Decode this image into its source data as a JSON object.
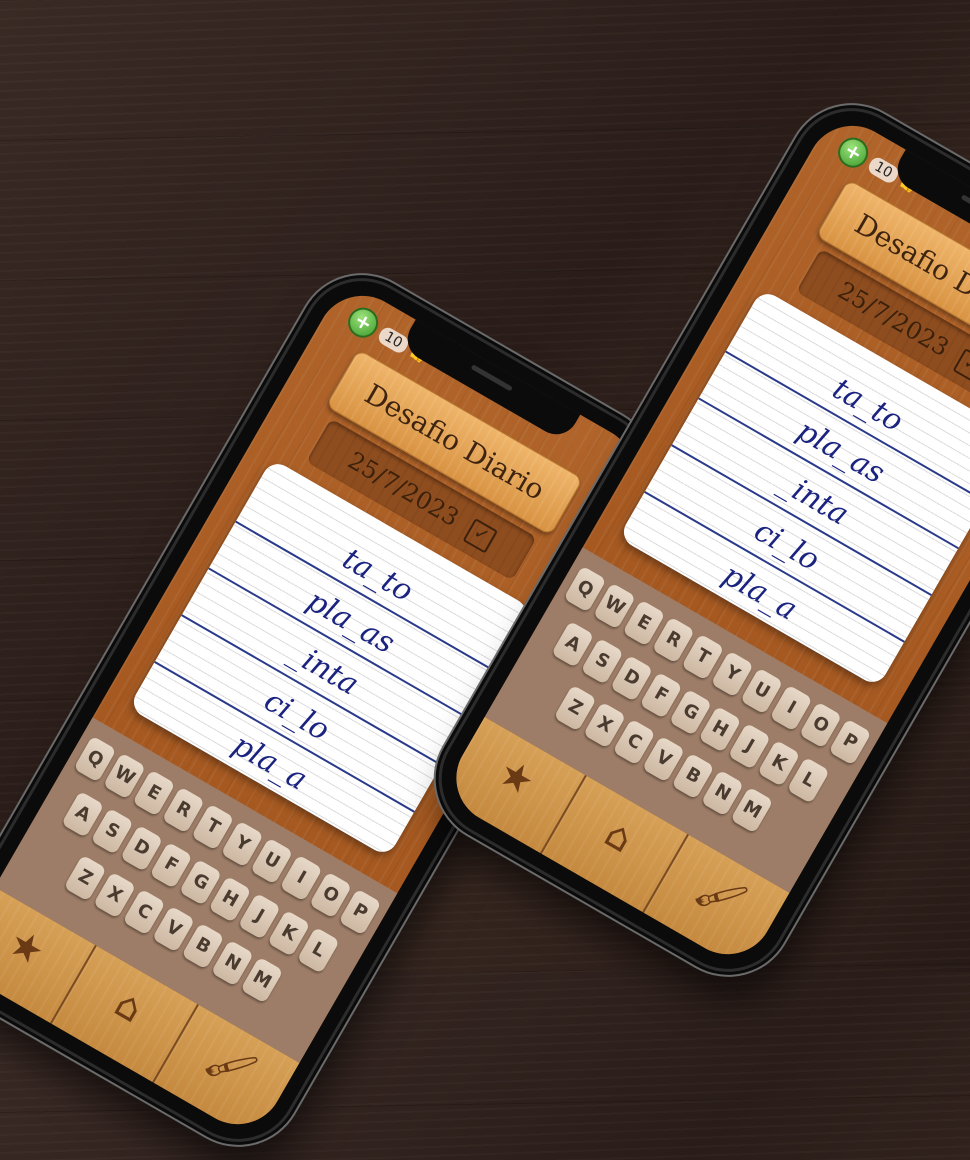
{
  "coins": {
    "count": "10"
  },
  "header": {
    "title": "Desafio Diario",
    "date": "25/7/2023"
  },
  "words": [
    "ta_to",
    "pla_as",
    "_inta",
    "ci_lo",
    "pla_a"
  ],
  "keyboard": {
    "row1": [
      "Q",
      "W",
      "E",
      "R",
      "T",
      "Y",
      "U",
      "I",
      "O",
      "P"
    ],
    "row2": [
      "A",
      "S",
      "D",
      "F",
      "G",
      "H",
      "J",
      "K",
      "L"
    ],
    "row3": [
      "Z",
      "X",
      "C",
      "V",
      "B",
      "N",
      "M"
    ]
  },
  "nav": {
    "star": "★",
    "home": "⌂",
    "paint": "🖌"
  },
  "icons": {
    "plus": "+",
    "thumb": "👍",
    "check": "✓"
  },
  "colors": {
    "wood": "#a85b22",
    "ink": "#1a2380",
    "keyboard_bg": "#9d7d67"
  }
}
